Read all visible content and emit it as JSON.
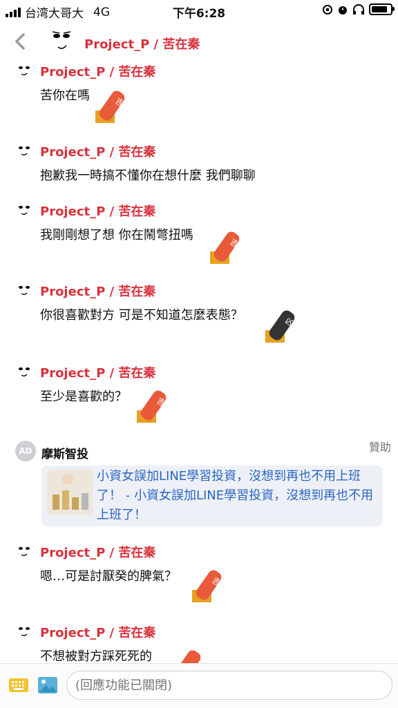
{
  "status_bar": {
    "carrier": "台湾大哥大",
    "network": "4G",
    "time": "下午6:28",
    "battery_level": 0.9
  },
  "header": {
    "title": "Project_P / 苦在秦",
    "back_icon": "chevron-left-icon"
  },
  "messages": [
    {
      "name": "Project_P / 苦在秦",
      "text": "苦你在嗎",
      "sticker_color": "#e85a3a",
      "sticker_char": "吉"
    },
    {
      "name": "Project_P / 苦在秦",
      "text": "抱歉我一時搞不懂你在想什麼 我們聊聊",
      "sticker_color": "",
      "sticker_char": ""
    },
    {
      "name": "Project_P / 苦在秦",
      "text": "我剛剛想了想 你在鬧彆扭嗎",
      "sticker_color": "#e85a3a",
      "sticker_char": "吉"
    },
    {
      "name": "Project_P / 苦在秦",
      "text": "你很喜歡對方 可是不知道怎麼表態？",
      "sticker_color": "#333333",
      "sticker_char": "凶"
    },
    {
      "name": "Project_P / 苦在秦",
      "text": "至少是喜歡的？",
      "sticker_color": "#e85a3a",
      "sticker_char": "吉"
    },
    {
      "name": "Project_P / 苦在秦",
      "text": "嗯…可是討厭癸的脾氣？",
      "sticker_color": "#e85a3a",
      "sticker_char": "吉"
    },
    {
      "name": "Project_P / 苦在秦",
      "text": "不想被對方踩死死的",
      "sticker_color": "#e85a3a",
      "sticker_char": ""
    }
  ],
  "ad": {
    "badge": "AD",
    "name": "摩斯智投",
    "sponsor_label": "贊助",
    "link_text": "小資女誤加LINE學習投資，沒想到再也不用上班了！ - 小資女誤加LINE學習投資，沒想到再也不用上班了！"
  },
  "input_bar": {
    "placeholder": "(回應功能已關閉)",
    "keyboard_icon": "keyboard-icon",
    "image_icon": "image-icon"
  },
  "colors": {
    "accent": "#d8323c",
    "link": "#2866c2",
    "ad_card_bg": "#eef0f8"
  }
}
